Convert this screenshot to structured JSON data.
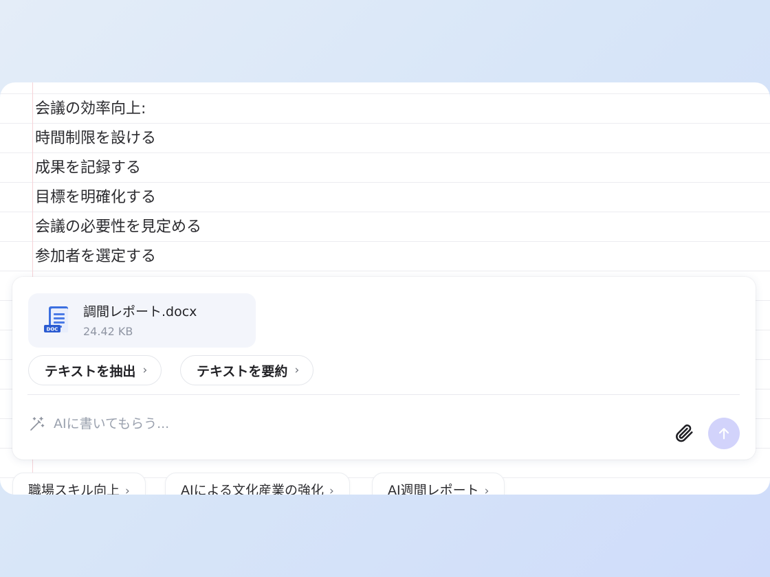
{
  "notes": {
    "lines": [
      "会議の効率向上:",
      "時間制限を設ける",
      "成果を記録する",
      "目標を明確化する",
      "会議の必要性を見定める",
      "参加者を選定する"
    ]
  },
  "attachment": {
    "icon": "doc-file-icon",
    "badge": "DOC",
    "name": "調間レポート.docx",
    "size": "24.42 KB"
  },
  "actions": [
    {
      "label": "テキストを抽出",
      "chevron": "›"
    },
    {
      "label": "テキストを要約",
      "chevron": "›"
    }
  ],
  "prompt": {
    "icon": "magic-wand-icon",
    "placeholder": "AIに書いてもらう...",
    "value": ""
  },
  "toolbar": {
    "attach_icon": "paperclip-icon",
    "send_icon": "arrow-up-icon",
    "send_color": "#d2d3fb"
  },
  "suggestions": [
    {
      "label": "職場スキル向上",
      "chevron": "›"
    },
    {
      "label": "AIによる文化産業の強化",
      "chevron": "›"
    },
    {
      "label": "AI週間レポート",
      "chevron": "›"
    }
  ]
}
